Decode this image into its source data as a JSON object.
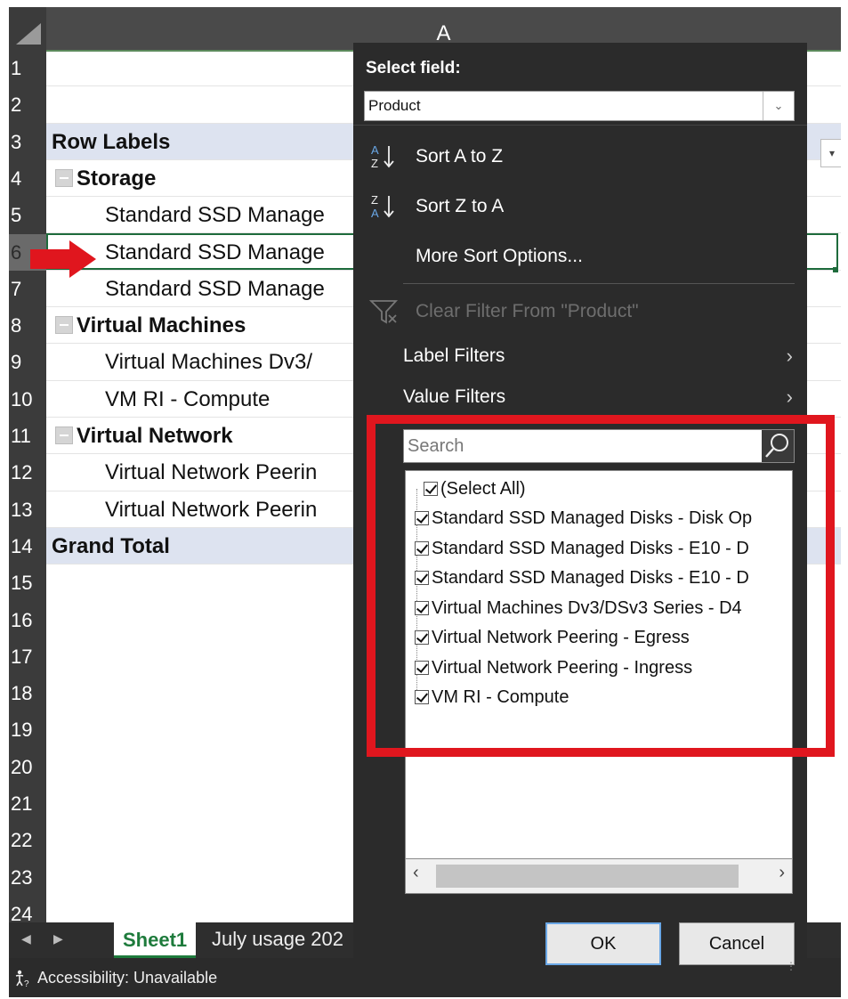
{
  "spreadsheet": {
    "column_header": "A",
    "row_numbers": [
      "1",
      "2",
      "3",
      "4",
      "5",
      "6",
      "7",
      "8",
      "9",
      "10",
      "11",
      "12",
      "13",
      "14",
      "15",
      "16",
      "17",
      "18",
      "19",
      "20",
      "21",
      "22",
      "23",
      "24"
    ],
    "selected_row": "6",
    "rows": {
      "r3": "Row Labels",
      "r4": "Storage",
      "r5": "Standard SSD Manage",
      "r6": "Standard SSD Manage",
      "r7": "Standard SSD Manage",
      "r8": "Virtual Machines",
      "r9": "Virtual Machines Dv3/",
      "r10": "VM RI - Compute",
      "r11": "Virtual Network",
      "r12": "Virtual Network Peerin",
      "r13": "Virtual Network Peerin",
      "r14": "Grand Total"
    },
    "dropdown_glyph": "▾"
  },
  "tabs": {
    "left_arrow": "◀",
    "right_arrow": "▶",
    "sheet1": "Sheet1",
    "july": "July usage 202"
  },
  "status": {
    "accessibility_icon": "accessibility-icon",
    "accessibility_text": "Accessibility: Unavailable"
  },
  "filter_panel": {
    "select_field_label": "Select field:",
    "field_value": "Product",
    "sort_az": "Sort A to Z",
    "sort_za": "Sort Z to A",
    "more_sort": "More Sort Options...",
    "clear_filter": "Clear Filter From \"Product\"",
    "label_filters": "Label Filters",
    "value_filters": "Value Filters",
    "search_placeholder": "Search",
    "items": [
      "(Select All)",
      "Standard SSD Managed Disks - Disk Op",
      "Standard SSD Managed Disks - E10 - D",
      "Standard SSD Managed Disks - E10 - D",
      "Virtual Machines Dv3/DSv3 Series - D4",
      "Virtual Network Peering - Egress",
      "Virtual Network Peering - Ingress",
      "VM RI - Compute"
    ],
    "ok": "OK",
    "cancel": "Cancel"
  },
  "colors": {
    "annotation_red": "#e0161e",
    "excel_green": "#1e7b3c",
    "panel_bg": "#2b2b2b"
  }
}
